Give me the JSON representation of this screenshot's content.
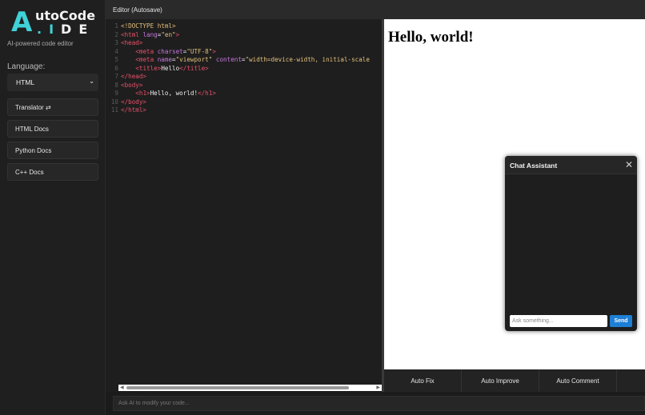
{
  "logo": {
    "big": "A",
    "top": "utoCode",
    "bottom_dot": ".",
    "bottom_i": "I",
    "bottom_rest": "DE"
  },
  "tagline": "AI-powered code editor",
  "language": {
    "label": "Language:",
    "selected": "HTML"
  },
  "nav": [
    "Translator ⇄",
    "HTML Docs",
    "Python Docs",
    "C++ Docs"
  ],
  "editor_title": "Editor (Autosave)",
  "code_lines": [
    [
      [
        "doc",
        "<!DOCTYPE html>"
      ]
    ],
    [
      [
        "tag",
        "<html "
      ],
      [
        "attr",
        "lang"
      ],
      [
        "txt",
        "="
      ],
      [
        "str",
        "\"en\""
      ],
      [
        "tag",
        ">"
      ]
    ],
    [
      [
        "tag",
        "<head>"
      ]
    ],
    [
      [
        "txt",
        "    "
      ],
      [
        "tag",
        "<meta "
      ],
      [
        "attr",
        "charset"
      ],
      [
        "txt",
        "="
      ],
      [
        "str",
        "\"UTF-8\""
      ],
      [
        "tag",
        ">"
      ]
    ],
    [
      [
        "txt",
        "    "
      ],
      [
        "tag",
        "<meta "
      ],
      [
        "attr",
        "name"
      ],
      [
        "txt",
        "="
      ],
      [
        "str",
        "\"viewport\" "
      ],
      [
        "attr",
        "content"
      ],
      [
        "txt",
        "="
      ],
      [
        "str",
        "\"width=device-width, initial-scale"
      ]
    ],
    [
      [
        "txt",
        "    "
      ],
      [
        "tag",
        "<title>"
      ],
      [
        "txt",
        "Hello"
      ],
      [
        "tag",
        "</title>"
      ]
    ],
    [
      [
        "tag",
        "</head>"
      ]
    ],
    [
      [
        "tag",
        "<body>"
      ]
    ],
    [
      [
        "txt",
        "    "
      ],
      [
        "tag",
        "<h1>"
      ],
      [
        "txt",
        "Hello, world!"
      ],
      [
        "tag",
        "</h1>"
      ]
    ],
    [
      [
        "tag",
        "</body>"
      ]
    ],
    [
      [
        "tag",
        "</html>"
      ]
    ]
  ],
  "preview_heading": "Hello, world!",
  "actions": [
    "Auto Fix",
    "Auto Improve",
    "Auto Comment"
  ],
  "ask_placeholder": "Ask AI to modify your code...",
  "chat": {
    "title": "Chat Assistant",
    "placeholder": "Ask something...",
    "send": "Send"
  }
}
